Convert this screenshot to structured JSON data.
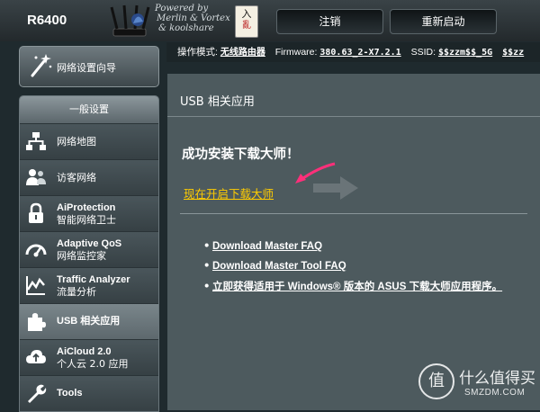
{
  "header": {
    "model": "R6400",
    "powered_lines": [
      "Powered by",
      "Merlin & Vortex",
      "& koolshare"
    ],
    "seal_top": "入",
    "seal_bottom": "亂",
    "logout_label": "注销",
    "reboot_label": "重新启动"
  },
  "statusbar": {
    "mode_label": "操作模式:",
    "mode_value": "无线路由器",
    "firmware_label": "Firmware:",
    "firmware_value": "380.63_2-X7.2.1",
    "ssid_label": "SSID:",
    "ssid_value_1": "$$zzm$$_5G",
    "ssid_value_2": "$$zz"
  },
  "sidebar": {
    "wizard_label": "网络设置向导",
    "section_title": "一般设置",
    "items": [
      {
        "icon": "network-map-icon",
        "en": "",
        "cn": "网络地图",
        "active": false
      },
      {
        "icon": "guest-network-icon",
        "en": "",
        "cn": "访客网络",
        "active": false
      },
      {
        "icon": "lock-icon",
        "en": "AiProtection",
        "cn": "智能网络卫士",
        "active": false
      },
      {
        "icon": "speedometer-icon",
        "en": "Adaptive QoS",
        "cn": "网络监控家",
        "active": false
      },
      {
        "icon": "traffic-chart-icon",
        "en": "Traffic Analyzer",
        "cn": "流量分析",
        "active": false
      },
      {
        "icon": "puzzle-icon",
        "en": "USB 相关应用",
        "cn": "",
        "active": true
      },
      {
        "icon": "cloud-icon",
        "en": "AiCloud 2.0",
        "cn": "个人云 2.0 应用",
        "active": false
      },
      {
        "icon": "wrench-icon",
        "en": "Tools",
        "cn": "",
        "active": false
      }
    ]
  },
  "main": {
    "title": "USB 相关应用",
    "success_text": "成功安装下载大师！",
    "start_link": "现在开启下载大师",
    "links": [
      "Download Master FAQ",
      "Download Master Tool FAQ",
      "立即获得适用于 Windows® 版本的 ASUS 下载大师应用程序。"
    ]
  },
  "watermark": {
    "glyph": "值",
    "cn": "什么值得买",
    "en": "SMZDM.COM"
  }
}
